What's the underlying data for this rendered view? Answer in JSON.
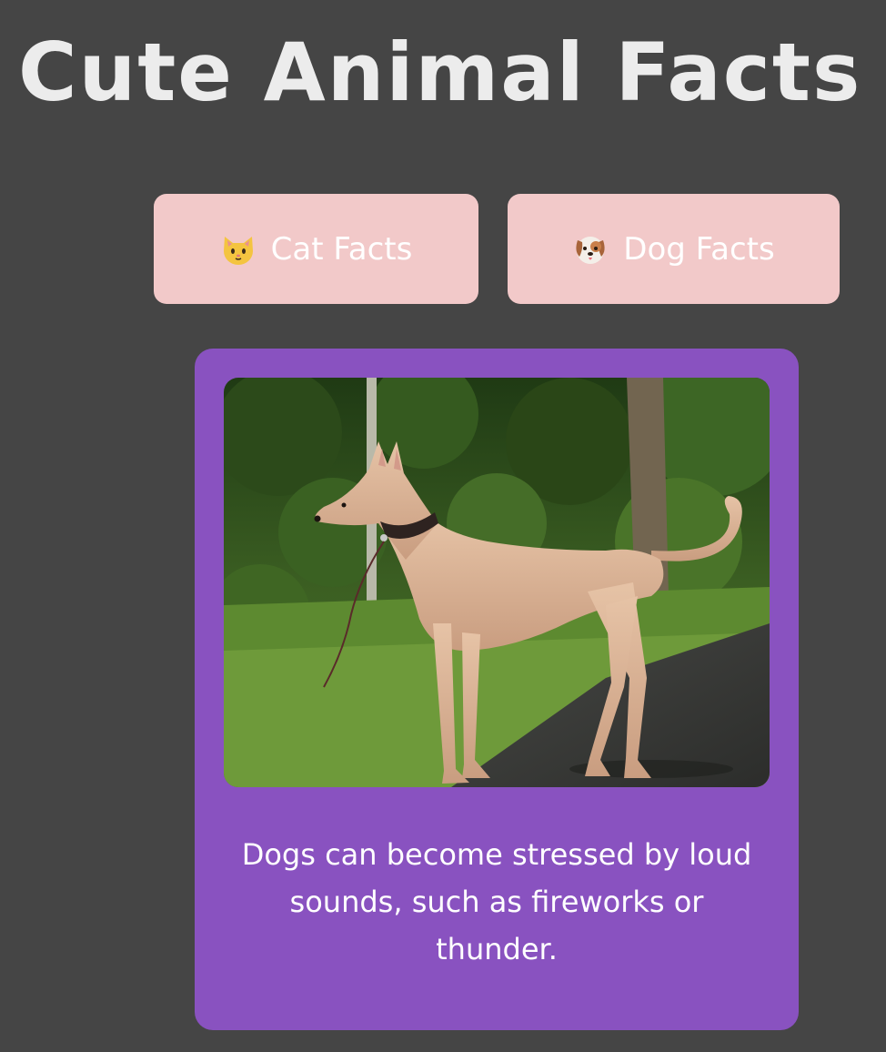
{
  "page": {
    "title": "Cute Animal Facts",
    "background_color": "#454545"
  },
  "buttons": {
    "cat": {
      "label": "Cat Facts",
      "icon": "cat-face-icon"
    },
    "dog": {
      "label": "Dog Facts",
      "icon": "dog-face-icon"
    },
    "color": "#f2c9c9"
  },
  "fact_card": {
    "color": "#8952c0",
    "image": {
      "subject": "dog-photo"
    },
    "fact": "Dogs can become stressed by loud sounds, such as fireworks or thunder."
  }
}
